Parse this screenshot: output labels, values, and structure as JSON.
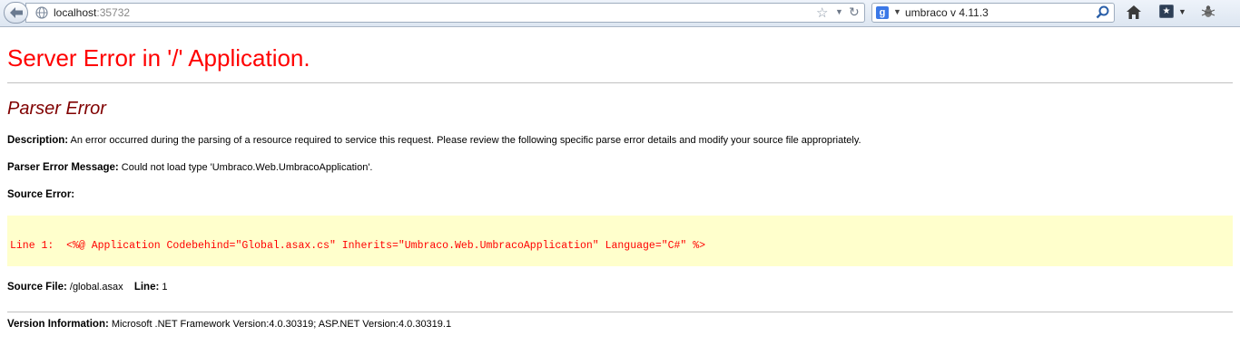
{
  "browser": {
    "url_host": "localhost",
    "url_port": ":35732",
    "search_text": "umbraco v 4.11.3"
  },
  "page": {
    "title": "Server Error in '/' Application.",
    "error_type": "Parser Error",
    "description": {
      "label": "Description:",
      "text": " An error occurred during the parsing of a resource required to service this request. Please review the following specific parse error details and modify your source file appropriately."
    },
    "parser_error_message": {
      "label": "Parser Error Message:",
      "text": " Could not load type 'Umbraco.Web.UmbracoApplication'."
    },
    "source_error": {
      "label": "Source Error:",
      "code_line": "Line 1:  <%@ Application Codebehind=\"Global.asax.cs\" Inherits=\"Umbraco.Web.UmbracoApplication\" Language=\"C#\" %>"
    },
    "source_file": {
      "label": "Source File:",
      "value": " /global.asax",
      "line_label": "Line:",
      "line_value": " 1"
    },
    "version_info": {
      "label": "Version Information:",
      "text": " Microsoft .NET Framework Version:4.0.30319; ASP.NET Version:4.0.30319.1"
    }
  },
  "colors": {
    "title": "#ff0000",
    "error_type": "#800000",
    "code_background": "#ffffcc",
    "code_text": "#ff0000"
  }
}
